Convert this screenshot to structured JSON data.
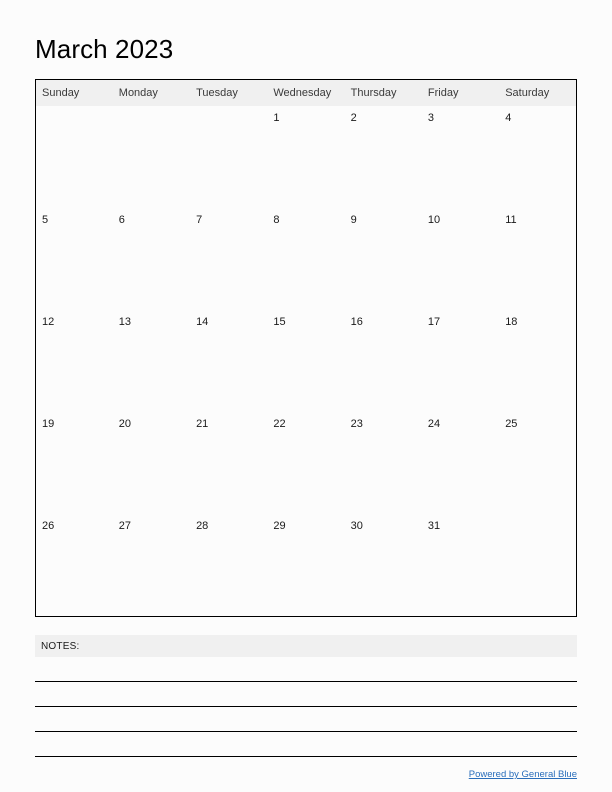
{
  "title": "March 2023",
  "calendar": {
    "weekday_headers": [
      "Sunday",
      "Monday",
      "Tuesday",
      "Wednesday",
      "Thursday",
      "Friday",
      "Saturday"
    ],
    "weeks": [
      [
        "",
        "",
        "",
        "1",
        "2",
        "3",
        "4"
      ],
      [
        "5",
        "6",
        "7",
        "8",
        "9",
        "10",
        "11"
      ],
      [
        "12",
        "13",
        "14",
        "15",
        "16",
        "17",
        "18"
      ],
      [
        "19",
        "20",
        "21",
        "22",
        "23",
        "24",
        "25"
      ],
      [
        "26",
        "27",
        "28",
        "29",
        "30",
        "31",
        ""
      ]
    ]
  },
  "notes": {
    "label": "NOTES:",
    "line_count": 4
  },
  "footer": {
    "link_text": "Powered by General Blue"
  },
  "colors": {
    "page_background": "#fcfcfc",
    "header_band": "#f0f0f0",
    "grid_border": "#000000",
    "link": "#2a6ebb",
    "text": "#1a1a1a"
  }
}
